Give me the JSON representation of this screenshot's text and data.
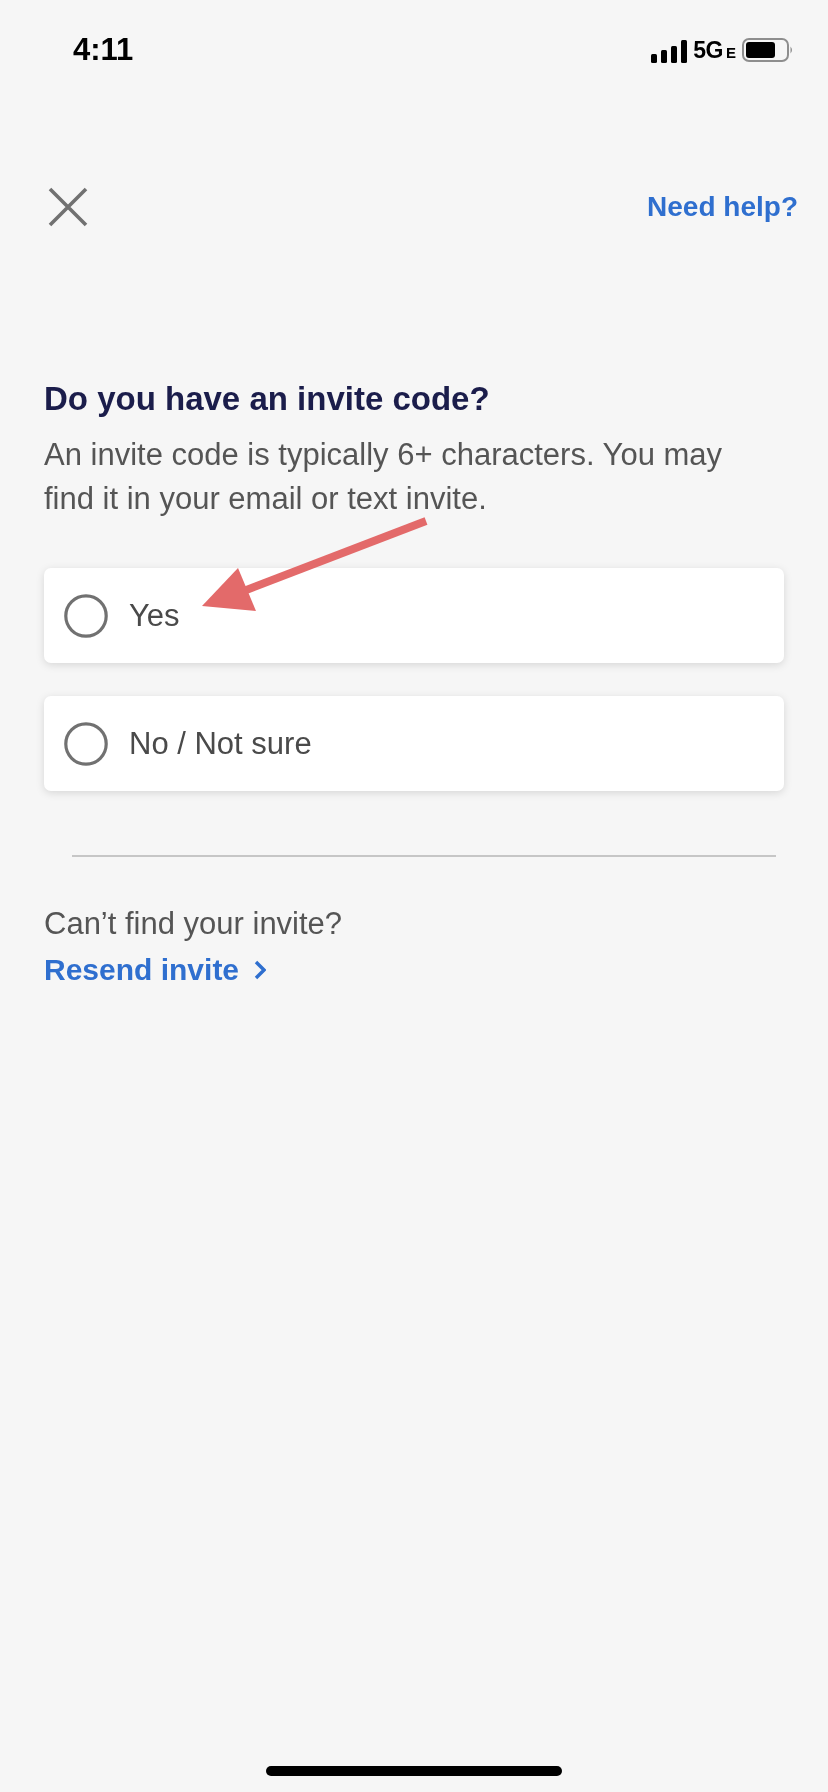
{
  "status_bar": {
    "time": "4:11",
    "network": "5G",
    "network_suffix": "E"
  },
  "header": {
    "help_link": "Need help?"
  },
  "question": {
    "title": "Do you have an invite code?",
    "description": "An invite code is typically 6+ characters. You may find it in your email or text invite."
  },
  "options": [
    {
      "label": "Yes",
      "selected": false
    },
    {
      "label": "No / Not sure",
      "selected": false
    }
  ],
  "footer": {
    "prompt": "Can’t find your invite?",
    "link": "Resend invite"
  }
}
